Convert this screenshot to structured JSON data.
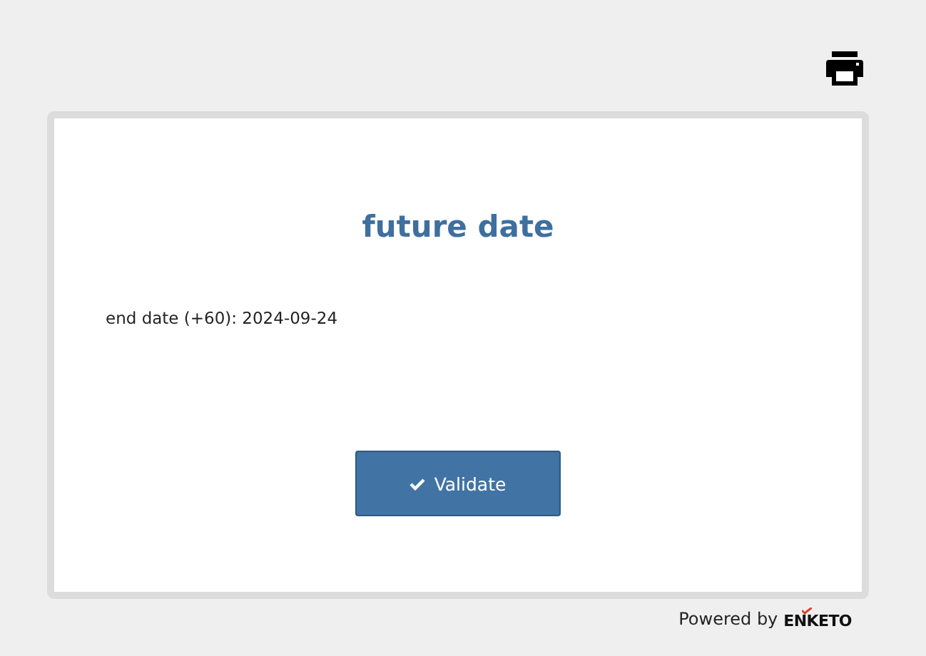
{
  "form": {
    "title": "future date",
    "note": "end date (+60): 2024-09-24",
    "validate_button": "Validate"
  },
  "footer": {
    "label": "Powered by",
    "brand": "ENKETO"
  }
}
